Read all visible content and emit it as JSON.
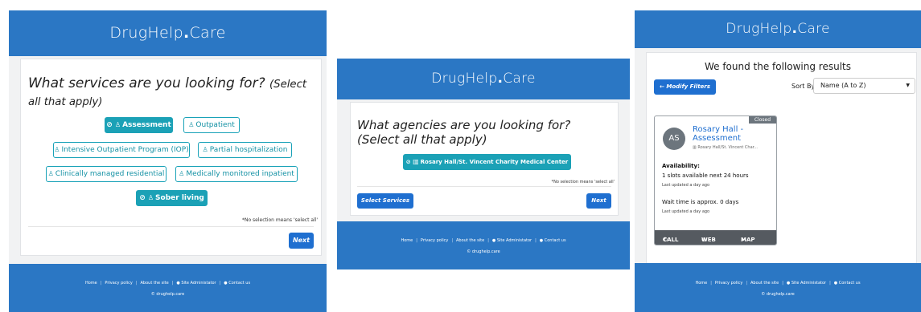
{
  "brand": {
    "name": "DrugHelp",
    "dot": ".",
    "tld": "Care"
  },
  "footer": {
    "links": [
      "Home",
      "Privacy policy",
      "About the site",
      "Site Administator",
      "Contact us"
    ],
    "separator": "|",
    "copyright": "© drughelp.care"
  },
  "services_step": {
    "question": "What services are you looking for?",
    "hint": "(Select all that apply)",
    "options": [
      {
        "label": "Assessment",
        "selected": true
      },
      {
        "label": "Outpatient",
        "selected": false
      },
      {
        "label": "Intensive Outpatient Program (IOP)",
        "selected": false
      },
      {
        "label": "Partial hospitalization",
        "selected": false
      },
      {
        "label": "Clinically managed residential",
        "selected": false
      },
      {
        "label": "Medically monitored inpatient",
        "selected": false
      },
      {
        "label": "Sober living",
        "selected": true
      }
    ],
    "note": "*No selection means 'select all'",
    "next_label": "Next"
  },
  "agencies_step": {
    "question": "What agencies are you looking for?",
    "hint": "(Select all that apply)",
    "options": [
      {
        "label": "Rosary Hall/St. Vincent Charity Medical Center",
        "selected": true
      }
    ],
    "note": "*No selection means 'select all'",
    "back_label": "Select Services",
    "next_label": "Next"
  },
  "results": {
    "title": "We found the following results",
    "modify_label": "Modify Filters",
    "sort_label": "Sort By:",
    "sort_value": "Name (A to Z)",
    "cards": [
      {
        "status": "Closed",
        "initials": "AS",
        "name": "Rosary Hall - Assessment",
        "org": "Rosary Hall/St. Vincent Char...",
        "availability_label": "Availability:",
        "availability": "1 slots available next 24 hours",
        "availability_updated": "Last updated a day ago",
        "wait": "Wait time is approx. 0 days",
        "wait_updated": "Last updated a day ago",
        "actions": [
          "CALL",
          "WEB",
          "MAP"
        ]
      }
    ]
  },
  "colors": {
    "header": "#2b77c4",
    "teal": "#1ba1b6",
    "primary": "#1f6fd0",
    "card_bar": "#555a60"
  }
}
